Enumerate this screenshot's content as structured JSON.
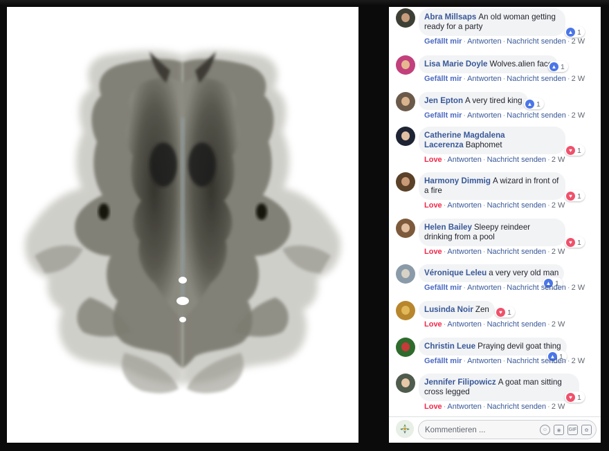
{
  "comments": [
    {
      "author": "Abra Millsaps",
      "text": "An old woman getting ready for a party",
      "reaction": "like",
      "reaction_count": "1",
      "action": "Gefällt mir",
      "reply": "Antworten",
      "message": "Nachricht senden",
      "time": "2 W",
      "avatar_colors": [
        "#3d3f35",
        "#c69c7d"
      ]
    },
    {
      "author": "Lisa Marie Doyle",
      "text": "Wolves.alien face",
      "reaction": "like",
      "reaction_count": "1",
      "action": "Gefällt mir",
      "reply": "Antworten",
      "message": "Nachricht senden",
      "time": "2 W",
      "avatar_colors": [
        "#c2407c",
        "#e5b98f"
      ]
    },
    {
      "author": "Jen Epton",
      "text": "A very tired king",
      "reaction": "like",
      "reaction_count": "1",
      "action": "Gefällt mir",
      "reply": "Antworten",
      "message": "Nachricht senden",
      "time": "2 W",
      "avatar_colors": [
        "#6b5a4a",
        "#d9b38e"
      ]
    },
    {
      "author": "Catherine Magdalena Lacerenza",
      "text": "Baphomet",
      "reaction": "love",
      "reaction_count": "1",
      "action": "Love",
      "reply": "Antworten",
      "message": "Nachricht senden",
      "time": "2 W",
      "avatar_colors": [
        "#1e2433",
        "#e2c1a3"
      ]
    },
    {
      "author": "Harmony Dimmig",
      "text": "A wizard in front of a fire",
      "reaction": "love",
      "reaction_count": "1",
      "action": "Love",
      "reply": "Antworten",
      "message": "Nachricht senden",
      "time": "2 W",
      "avatar_colors": [
        "#5a4128",
        "#c99a77"
      ]
    },
    {
      "author": "Helen Bailey",
      "text": "Sleepy reindeer drinking from a pool",
      "reaction": "love",
      "reaction_count": "1",
      "action": "Love",
      "reply": "Antworten",
      "message": "Nachricht senden",
      "time": "2 W",
      "avatar_colors": [
        "#7d5a3c",
        "#e3c0a1"
      ]
    },
    {
      "author": "Véronique Leleu",
      "text": "a very very old man",
      "reaction": "like",
      "reaction_count": "1",
      "action": "Gefällt mir",
      "reply": "Antworten",
      "message": "Nachricht senden",
      "time": "2 W",
      "avatar_colors": [
        "#8a9aa8",
        "#d8d2c6"
      ]
    },
    {
      "author": "Lusinda Noir",
      "text": "Zen",
      "reaction": "love",
      "reaction_count": "1",
      "action": "Love",
      "reply": "Antworten",
      "message": "Nachricht senden",
      "time": "2 W",
      "avatar_colors": [
        "#b8862c",
        "#e0b85a"
      ]
    },
    {
      "author": "Christin Leue",
      "text": "Praying devil goat thing",
      "reaction": "like",
      "reaction_count": "1",
      "action": "Gefällt mir",
      "reply": "Antworten",
      "message": "Nachricht senden",
      "time": "2 W",
      "avatar_colors": [
        "#2f6b2c",
        "#c63a3a"
      ]
    },
    {
      "author": "Jennifer Filipowicz",
      "text": "A goat man sitting cross legged",
      "reaction": "love",
      "reaction_count": "1",
      "action": "Love",
      "reply": "Antworten",
      "message": "Nachricht senden",
      "time": "2 W",
      "avatar_colors": [
        "#4f5b4c",
        "#e6c7a8"
      ]
    }
  ],
  "composer": {
    "placeholder": "Kommentieren ..."
  },
  "composer_icons": [
    "emoji-icon",
    "camera-icon",
    "gif-icon",
    "sticker-icon"
  ],
  "colors": {
    "author": "#385898",
    "like": "#4b76e8",
    "love": "#f0506b",
    "bubble": "#f2f3f5"
  }
}
